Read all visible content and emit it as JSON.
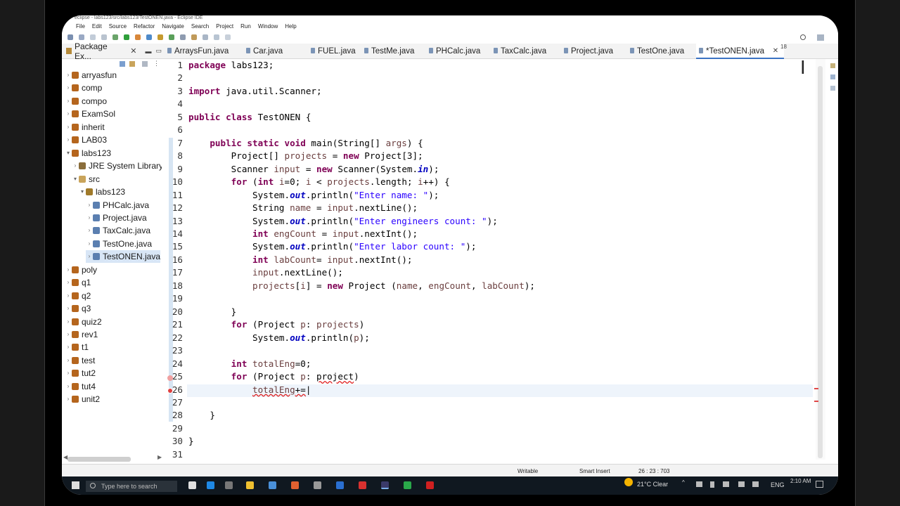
{
  "window": {
    "title": "eclipse - labs123/src/labs123/TestONEN.java - Eclipse IDE"
  },
  "menu": [
    "File",
    "Edit",
    "Source",
    "Refactor",
    "Navigate",
    "Search",
    "Project",
    "Run",
    "Window",
    "Help"
  ],
  "package_explorer": {
    "title": "Package Ex...",
    "items": [
      {
        "label": "arryasfun",
        "indent": 0,
        "type": "project"
      },
      {
        "label": "comp",
        "indent": 0,
        "type": "project"
      },
      {
        "label": "compo",
        "indent": 0,
        "type": "project"
      },
      {
        "label": "ExamSol",
        "indent": 0,
        "type": "project"
      },
      {
        "label": "inherit",
        "indent": 0,
        "type": "project"
      },
      {
        "label": "LAB03",
        "indent": 0,
        "type": "project"
      },
      {
        "label": "labs123",
        "indent": 0,
        "type": "project",
        "expanded": true
      },
      {
        "label": "JRE System Library",
        "indent": 1,
        "type": "library"
      },
      {
        "label": "src",
        "indent": 1,
        "type": "folder",
        "expanded": true
      },
      {
        "label": "labs123",
        "indent": 2,
        "type": "package",
        "expanded": true
      },
      {
        "label": "PHCalc.java",
        "indent": 3,
        "type": "file"
      },
      {
        "label": "Project.java",
        "indent": 3,
        "type": "file"
      },
      {
        "label": "TaxCalc.java",
        "indent": 3,
        "type": "file"
      },
      {
        "label": "TestOne.java",
        "indent": 3,
        "type": "file"
      },
      {
        "label": "TestONEN.java",
        "indent": 3,
        "type": "file",
        "selected": true
      },
      {
        "label": "poly",
        "indent": 0,
        "type": "project"
      },
      {
        "label": "q1",
        "indent": 0,
        "type": "project"
      },
      {
        "label": "q2",
        "indent": 0,
        "type": "project"
      },
      {
        "label": "q3",
        "indent": 0,
        "type": "project"
      },
      {
        "label": "quiz2",
        "indent": 0,
        "type": "project"
      },
      {
        "label": "rev1",
        "indent": 0,
        "type": "project"
      },
      {
        "label": "t1",
        "indent": 0,
        "type": "project"
      },
      {
        "label": "test",
        "indent": 0,
        "type": "project"
      },
      {
        "label": "tut2",
        "indent": 0,
        "type": "project"
      },
      {
        "label": "tut4",
        "indent": 0,
        "type": "project"
      },
      {
        "label": "unit2",
        "indent": 0,
        "type": "project"
      }
    ]
  },
  "editor_tabs": [
    {
      "label": "ArraysFun.java"
    },
    {
      "label": "Car.java"
    },
    {
      "label": "FUEL.java"
    },
    {
      "label": "TestMe.java"
    },
    {
      "label": "PHCalc.java"
    },
    {
      "label": "TaxCalc.java"
    },
    {
      "label": "Project.java"
    },
    {
      "label": "TestOne.java"
    },
    {
      "label": "*TestONEN.java",
      "active": true
    }
  ],
  "tab_overflow": "18",
  "code_lines": [
    {
      "n": "1",
      "html": "<span class='kw'>package</span> labs123;"
    },
    {
      "n": "2",
      "html": ""
    },
    {
      "n": "3",
      "html": "<span class='kw'>import</span> java.util.Scanner;"
    },
    {
      "n": "4",
      "html": ""
    },
    {
      "n": "5",
      "html": "<span class='kw'>public class</span> TestONEN {"
    },
    {
      "n": "6",
      "html": ""
    },
    {
      "n": "7",
      "html": "    <span class='kw'>public static void</span> main(String[] <span class='var'>args</span>) {"
    },
    {
      "n": "8",
      "html": "        Project[] <span class='var'>projects</span> = <span class='kw'>new</span> Project[3];"
    },
    {
      "n": "9",
      "html": "        Scanner <span class='var'>input</span> = <span class='kw'>new</span> Scanner(System.<span class='fld'>in</span>);"
    },
    {
      "n": "10",
      "html": "        <span class='kw'>for</span> (<span class='kw'>int</span> <span class='var'>i</span>=0; <span class='var'>i</span> &lt; <span class='var'>projects</span>.length; <span class='var'>i</span>++) {"
    },
    {
      "n": "11",
      "html": "            System.<span class='fld'>out</span>.println(<span class='str'>\"Enter name: \"</span>);"
    },
    {
      "n": "12",
      "html": "            String <span class='var'>name</span> = <span class='var'>input</span>.nextLine();"
    },
    {
      "n": "13",
      "html": "            System.<span class='fld'>out</span>.println(<span class='str'>\"Enter engineers count: \"</span>);"
    },
    {
      "n": "14",
      "html": "            <span class='kw'>int</span> <span class='var'>engCount</span> = <span class='var'>input</span>.nextInt();"
    },
    {
      "n": "15",
      "html": "            System.<span class='fld'>out</span>.println(<span class='str'>\"Enter labor count: \"</span>);"
    },
    {
      "n": "16",
      "html": "            <span class='kw'>int</span> <span class='var'>labCount</span>= <span class='var'>input</span>.nextInt();"
    },
    {
      "n": "17",
      "html": "            <span class='var'>input</span>.nextLine();"
    },
    {
      "n": "18",
      "html": "            <span class='var'>projects</span>[<span class='var'>i</span>] = <span class='kw'>new</span> Project (<span class='var'>name</span>, <span class='var'>engCount</span>, <span class='var'>labCount</span>);"
    },
    {
      "n": "19",
      "html": ""
    },
    {
      "n": "20",
      "html": "        }"
    },
    {
      "n": "21",
      "html": "        <span class='kw'>for</span> (Project <span class='var'>p</span>: <span class='var'>projects</span>)"
    },
    {
      "n": "22",
      "html": "            System.<span class='fld'>out</span>.println(<span class='var'>p</span>);"
    },
    {
      "n": "23",
      "html": ""
    },
    {
      "n": "24",
      "html": "        <span class='kw'>int</span> <span class='var'>totalEng</span>=0;"
    },
    {
      "n": "25",
      "html": "        <span class='kw'>for</span> (Project <span class='var'>p</span>: <span class='err'>project</span>)"
    },
    {
      "n": "26",
      "html": "            <span class='err'><span class='var'>totalEng</span>+=</span>|"
    },
    {
      "n": "27",
      "html": ""
    },
    {
      "n": "28",
      "html": "    }"
    },
    {
      "n": "29",
      "html": ""
    },
    {
      "n": "30",
      "html": "}"
    },
    {
      "n": "31",
      "html": ""
    }
  ],
  "status": {
    "writable": "Writable",
    "insert_mode": "Smart Insert",
    "position": "26 : 23 : 703"
  },
  "taskbar": {
    "search_placeholder": "Type here to search",
    "weather": "21°C Clear",
    "language": "ENG",
    "time": "2:10 AM"
  }
}
